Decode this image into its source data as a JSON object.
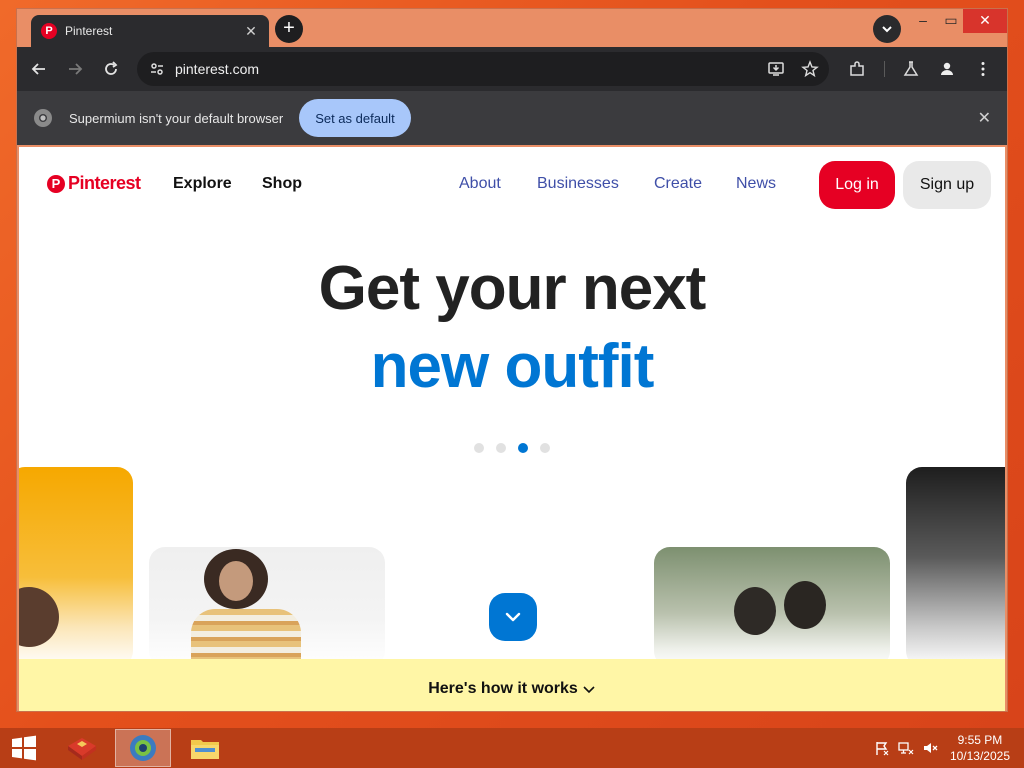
{
  "browser": {
    "tab_title": "Pinterest",
    "tab_favicon_letter": "P",
    "url": "pinterest.com",
    "infobar_text": "Supermium isn't your default browser",
    "set_default_label": "Set as default"
  },
  "pinterest": {
    "logo_text": "Pinterest",
    "header_links": [
      "Explore",
      "Shop"
    ],
    "nav": [
      "About",
      "Businesses",
      "Create",
      "News"
    ],
    "login_label": "Log in",
    "signup_label": "Sign up",
    "hero_line1": "Get your next",
    "hero_line2": "new outfit",
    "carousel_dots": 4,
    "carousel_active_index": 2,
    "how_it_works": "Here's how it works"
  },
  "colors": {
    "brand_red": "#e60023",
    "accent_blue": "#0076d3",
    "nav_link": "#3f4fa8",
    "banner_yellow": "#fff6a6"
  },
  "taskbar": {
    "time": "9:55 PM",
    "date": "10/13/2025"
  }
}
